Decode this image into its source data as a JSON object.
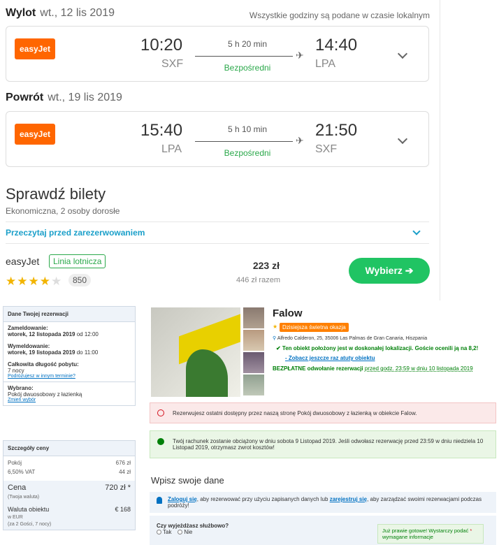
{
  "outbound": {
    "label": "Wylot",
    "date": "wt., 12 lis 2019",
    "airline_logo": "easyJet",
    "dep_time": "10:20",
    "dep_code": "SXF",
    "duration": "5 h 20 min",
    "stops": "Bezpośredni",
    "arr_time": "14:40",
    "arr_code": "LPA"
  },
  "return": {
    "label": "Powrót",
    "date": "wt., 19 lis 2019",
    "airline_logo": "easyJet",
    "dep_time": "15:40",
    "dep_code": "LPA",
    "duration": "5 h 10 min",
    "stops": "Bezpośredni",
    "arr_time": "21:50",
    "arr_code": "SXF"
  },
  "timezone_note": "Wszystkie godziny są podane w czasie lokalnym",
  "tickets": {
    "title": "Sprawdź bilety",
    "subtitle": "Ekonomiczna, 2 osoby dorosłe",
    "read_before": "Przeczytaj przed zarezerwowaniem",
    "airline": "easyJet",
    "airline_badge": "Linia lotnicza",
    "rating_stars": 4,
    "rating_max": 5,
    "review_count": "850",
    "price": "223 zł",
    "price_total": "446 zł razem",
    "select_button": "Wybierz ➔"
  },
  "booking": {
    "sidebar": {
      "title": "Dane Twojej rezerwacji",
      "checkin_label": "Zameldowanie:",
      "checkin_value": "wtorek, 12 listopada 2019",
      "checkin_time": "od 12:00",
      "checkout_label": "Wymeldowanie:",
      "checkout_value": "wtorek, 19 listopada 2019",
      "checkout_time": "do 11:00",
      "length_label": "Całkowita długość pobytu:",
      "length_value": "7 nocy",
      "change_dates": "Podróżujesz w innym terminie?",
      "chosen_label": "Wybrano:",
      "chosen_value": "Pokój dwuosobowy z łazienką",
      "change_choice": "Zmień wybór"
    },
    "price_details": {
      "title": "Szczegóły ceny",
      "room_label": "Pokój",
      "room_value": "676 zł",
      "vat_label": "6,50% VAT",
      "vat_value": "44 zł",
      "total_label": "Cena",
      "total_sub": "(Twoja waluta)",
      "total_value": "720 zł *",
      "prop_label": "Waluta obiektu",
      "prop_sub": "w EUR",
      "prop_value": "€ 168",
      "guests": "(za 2 Gości, 7 nocy)"
    },
    "hotel": {
      "name": "Falow",
      "deal": "Dzisiejsza świetna okazja",
      "address": "Alfredo Calderon, 25, 35006 Las Palmas de Gran Canaria, Hiszpania",
      "location_note": "✔ Ten obiekt położony jest w doskonałej lokalizacji. Goście ocenili ją na 8,2!",
      "see_more": "Zobacz jeszcze raz atuty obiektu",
      "cancel_bold": "BEZPŁATNE odwołanie rezerwacji",
      "cancel_rest": "przed godz. 23:59 w dniu 10 listopada 2019"
    },
    "alert_last": "Rezerwujesz ostatni dostępny przez naszą stronę Pokój dwuosobowy z łazienką w obiekcie Falow.",
    "alert_charge": "Twój rachunek zostanie obciążony w dniu sobota 9 Listopad 2019. Jeśli odwołasz rezerwację przed 23:59 w dniu niedziela 10 Listopad 2019, otrzymasz zwrot kosztów!",
    "form_title": "Wpisz swoje dane",
    "login_link": "Zaloguj się",
    "login_mid": ", aby rezerwować przy użyciu zapisanych danych lub",
    "register_link": "zarejestruj się",
    "login_end": ", aby zarządzać swoimi rezerwacjami podczas podróży!",
    "business_q": "Czy wyjeżdżasz służbowo?",
    "yes": "Tak",
    "no": "Nie",
    "ready_note": "Już prawie gotowe! Wystarczy podać",
    "ready_note2": "wymagane informacje",
    "ready_star": "*"
  }
}
